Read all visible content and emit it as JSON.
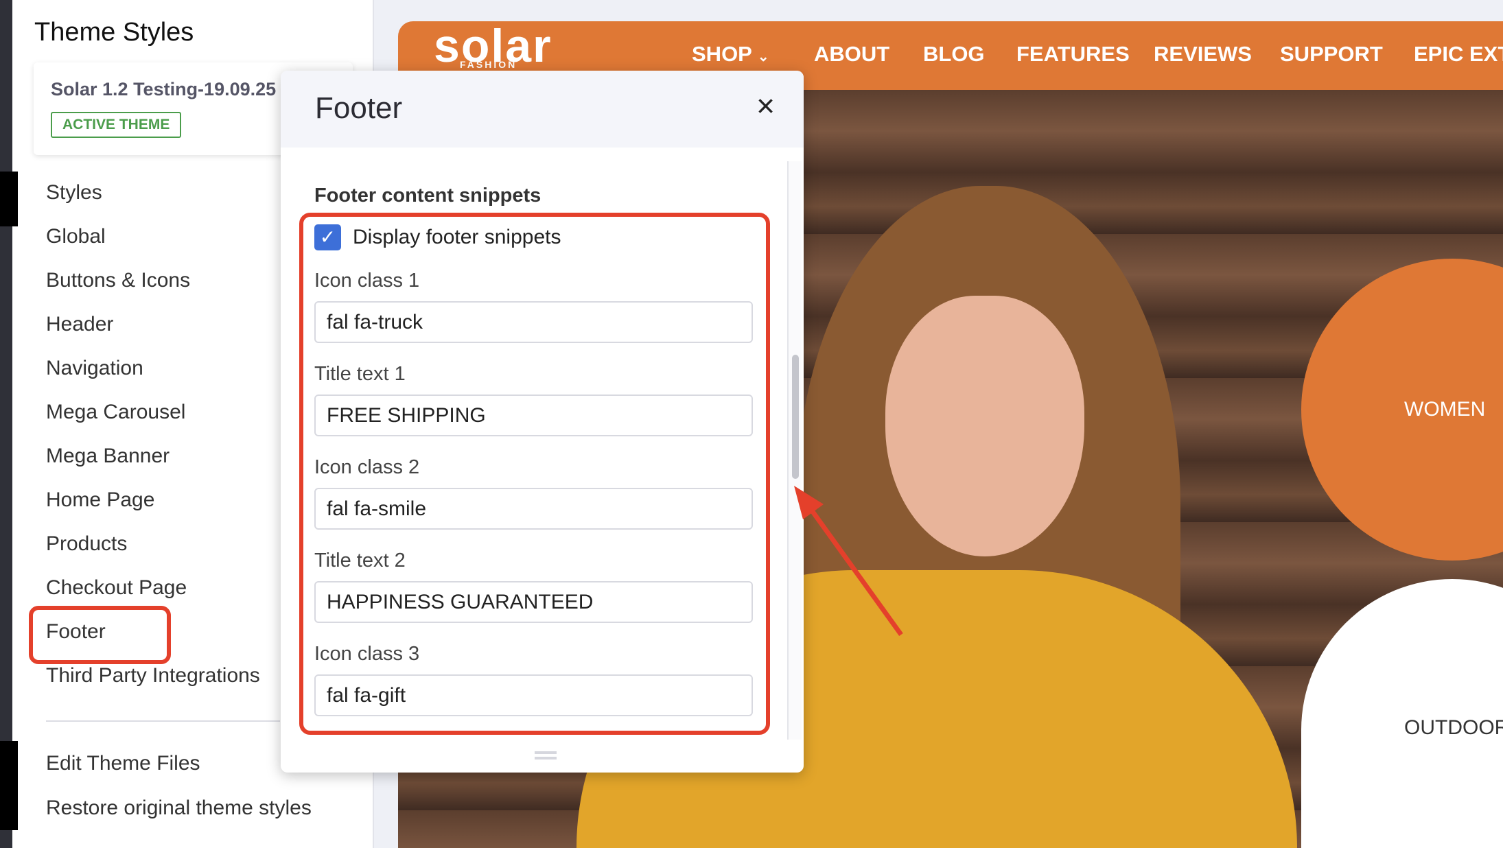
{
  "sidebar": {
    "title": "Theme Styles",
    "theme_name": "Solar 1.2 Testing-19.09.25",
    "badge": "ACTIVE THEME",
    "items": [
      "Styles",
      "Global",
      "Buttons & Icons",
      "Header",
      "Navigation",
      "Mega Carousel",
      "Mega Banner",
      "Home Page",
      "Products",
      "Checkout Page",
      "Footer",
      "Third Party Integrations"
    ],
    "bottom": [
      "Edit Theme Files",
      "Restore original theme styles"
    ],
    "selected": "Footer"
  },
  "preview": {
    "logo": "solar",
    "logo_sub": "FASHION",
    "menu": [
      "SHOP",
      "ABOUT",
      "BLOG",
      "FEATURES",
      "REVIEWS",
      "SUPPORT",
      "EPIC EXTR"
    ],
    "circles": [
      "WOMEN",
      "OUTDOOR"
    ],
    "brand_color": "#df7835"
  },
  "modal": {
    "title": "Footer",
    "section": "Footer content snippets",
    "checkbox_label": "Display footer snippets",
    "checked": true,
    "fields": [
      {
        "label": "Icon class 1",
        "value": "fal fa-truck"
      },
      {
        "label": "Title text 1",
        "value": "FREE SHIPPING"
      },
      {
        "label": "Icon class 2",
        "value": "fal fa-smile"
      },
      {
        "label": "Title text 2",
        "value": "HAPPINESS GUARANTEED"
      },
      {
        "label": "Icon class 3",
        "value": "fal fa-gift"
      }
    ]
  },
  "annotation_color": "#e4402b"
}
